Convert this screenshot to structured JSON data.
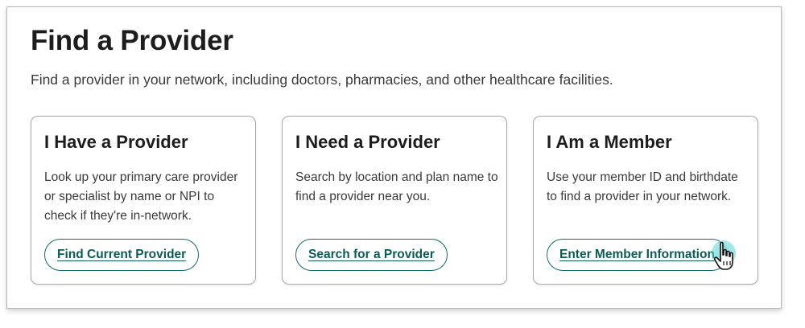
{
  "header": {
    "title": "Find a Provider",
    "description": "Find a provider in your network, including doctors, pharmacies, and other healthcare facilities."
  },
  "cards": [
    {
      "title": "I Have a Provider",
      "description": "Look up your primary care provider or specialist by name or NPI to check if they're in-network.",
      "button_label": "Find Current Provider"
    },
    {
      "title": "I Need a Provider",
      "description": "Search by location and plan name to find a provider near you.",
      "button_label": "Search for a Provider"
    },
    {
      "title": "I Am a Member",
      "description": "Use your member ID and birthdate to find a provider in your network.",
      "button_label": "Enter Member Information"
    }
  ],
  "cursor": {
    "icon": "hand-pointer-icon",
    "highlight_color": "#5fd3d6"
  },
  "colors": {
    "button_text": "#0b5c55",
    "button_border": "#0f6b63",
    "heading": "#1d1d1d"
  }
}
